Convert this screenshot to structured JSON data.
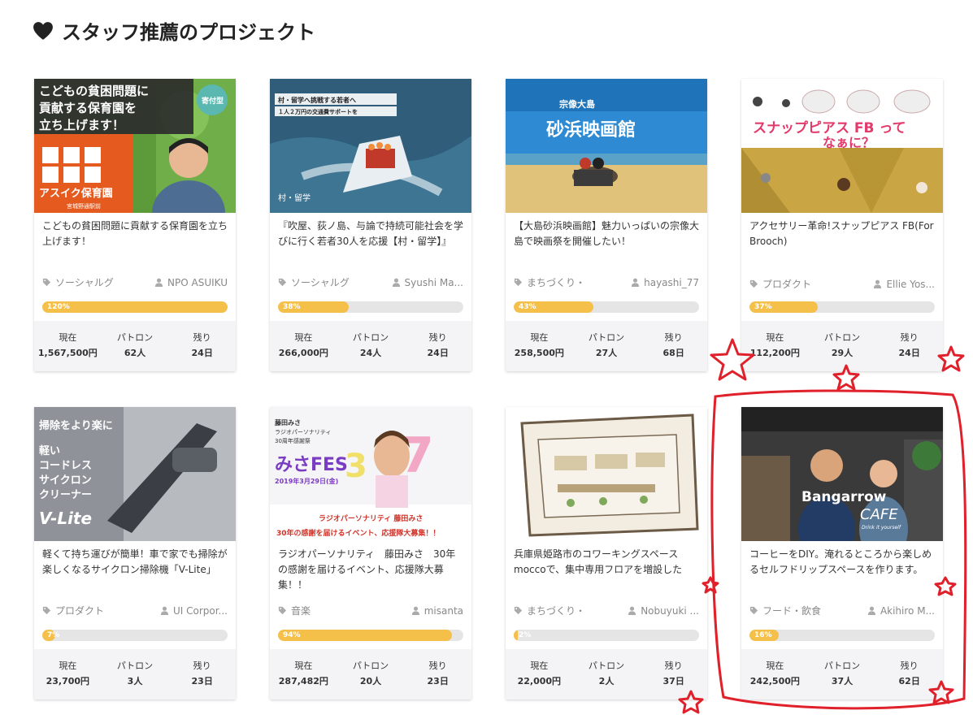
{
  "section": {
    "title": "スタッフ推薦のプロジェクト",
    "icon": "heart-icon"
  },
  "stat_labels": {
    "current": "現在",
    "patrons": "パトロン",
    "remaining": "残り"
  },
  "cards": [
    {
      "title": "こどもの貧困問題に貢献する保育園を立ち上げます！",
      "category": "ソーシャルグ",
      "owner": "NPO ASUIKU",
      "progress": "120%",
      "progress_value": 1.0,
      "current": "1,567,500円",
      "patrons": "62人",
      "remaining": "24日",
      "image_text": {
        "line1": "こどもの貧困問題に",
        "line2": "貢献する保育園を",
        "line3": "立ち上げます！",
        "badge": "寄付型",
        "logo": "アスイク保育園",
        "logo_sub": "宮城野通駅前"
      }
    },
    {
      "title": "『吹屋、荻ノ島、与論で持続可能社会を学びに行く若者30人を応援【村・留学】』",
      "category": "ソーシャルグ",
      "owner": "Syushi Ma...",
      "progress": "38%",
      "progress_value": 0.38,
      "current": "266,000円",
      "patrons": "24人",
      "remaining": "24日",
      "image_text": {
        "line1": "村・留学へ挑戦する若者へ",
        "line2": "１人２万円の交通費サポートを",
        "logo": "村・留学"
      }
    },
    {
      "title": "【大島砂浜映画館】魅力いっぱいの宗像大島で映画祭を開催したい！",
      "category": "まちづくり・",
      "owner": "hayashi_77",
      "progress": "43%",
      "progress_value": 0.43,
      "current": "258,500円",
      "patrons": "27人",
      "remaining": "68日",
      "image_text": {
        "line1": "宗像大島",
        "line2": "砂浜映画館"
      }
    },
    {
      "title": "アクセサリー革命!スナップピアス FB(For Brooch)",
      "category": "プロダクト",
      "owner": "Ellie Yos...",
      "progress": "37%",
      "progress_value": 0.37,
      "current": "112,200円",
      "patrons": "29人",
      "remaining": "24日",
      "image_text": {
        "line1": "スナップピアス FB って",
        "line2": "なぁに？"
      }
    },
    {
      "title": "軽くて持ち運びが簡単！車で家でも掃除が楽しくなるサイクロン掃除機「V-Lite」",
      "category": "プロダクト",
      "owner": "UI Corpor...",
      "progress": "7%",
      "progress_value": 0.07,
      "current": "23,700円",
      "patrons": "3人",
      "remaining": "23日",
      "image_text": {
        "line1": "掃除をより楽に",
        "line2": "軽い",
        "line3": "コードレス",
        "line4": "サイクロン",
        "line5": "クリーナー",
        "logo": "V-Lite"
      }
    },
    {
      "title": "ラジオパーソナリティ　藤田みさ　30年の感謝を届けるイベント、応援隊大募集！！",
      "category": "音楽",
      "owner": "misanta",
      "progress": "94%",
      "progress_value": 0.94,
      "current": "287,482円",
      "patrons": "20人",
      "remaining": "23日",
      "image_text": {
        "line1": "藤田みさ",
        "line2": "ラジオパーソナリティ",
        "line3": "30周年感謝祭",
        "logo": "みさFES",
        "date": "2019年3月29日(金)",
        "caption1": "ラジオパーソナリティ 藤田みさ",
        "caption2": "30年の感謝を届けるイベント、応援隊大募集！！"
      }
    },
    {
      "title": "兵庫県姫路市のコワーキングスペースmoccoで、集中専用フロアを増設したい！",
      "category": "まちづくり・",
      "owner": "Nobuyuki ...",
      "progress": "2%",
      "progress_value": 0.02,
      "current": "22,000円",
      "patrons": "2人",
      "remaining": "37日",
      "image_text": {}
    },
    {
      "title": "コーヒーをDIY。淹れるところから楽しめるセルフドリップスペースを作ります。",
      "category": "フード・飲食",
      "owner": "Akihiro M...",
      "progress": "16%",
      "progress_value": 0.16,
      "current": "242,500円",
      "patrons": "37人",
      "remaining": "62日",
      "image_text": {
        "line1": "Bangarrow",
        "line2": "CAFE",
        "line3": "Drink it yourself"
      }
    }
  ],
  "annotation_color": "#e0202a"
}
